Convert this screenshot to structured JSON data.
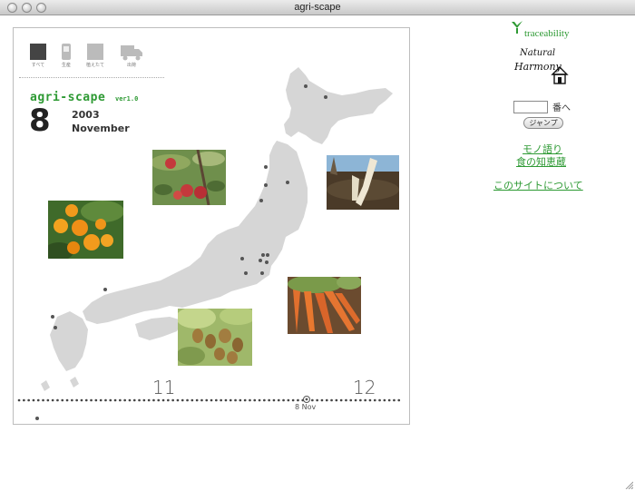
{
  "window": {
    "title": "agri-scape"
  },
  "modes": [
    {
      "label": "すべて",
      "icon": "all-square-icon"
    },
    {
      "label": "生産",
      "icon": "phone-icon"
    },
    {
      "label": "植えたて",
      "icon": "grey-square-icon"
    },
    {
      "label": "出荷",
      "icon": "truck-icon"
    }
  ],
  "header": {
    "brand": "agri-scape",
    "version": "ver1.0",
    "day": "8",
    "year": "2003",
    "month": "November"
  },
  "timeline": {
    "tick_left": "11",
    "tick_right": "12",
    "current_label": "8 Nov"
  },
  "photos": [
    {
      "name": "photo-apples",
      "subject": "apples"
    },
    {
      "name": "photo-daikon",
      "subject": "daikon radish"
    },
    {
      "name": "photo-oranges",
      "subject": "oranges"
    },
    {
      "name": "photo-carrots",
      "subject": "carrots"
    },
    {
      "name": "photo-kiwi",
      "subject": "kiwi"
    }
  ],
  "sidebar": {
    "traceability": "traceability",
    "logo_text": "Natural Harmony",
    "jump_suffix": "番へ",
    "jump_button": "ジャンプ",
    "links": [
      "モノ語り",
      "食の知恵蔵",
      "このサイトについて"
    ]
  },
  "colors": {
    "accent": "#2e9a34",
    "map": "#d6d6d6",
    "dot": "#555555"
  }
}
